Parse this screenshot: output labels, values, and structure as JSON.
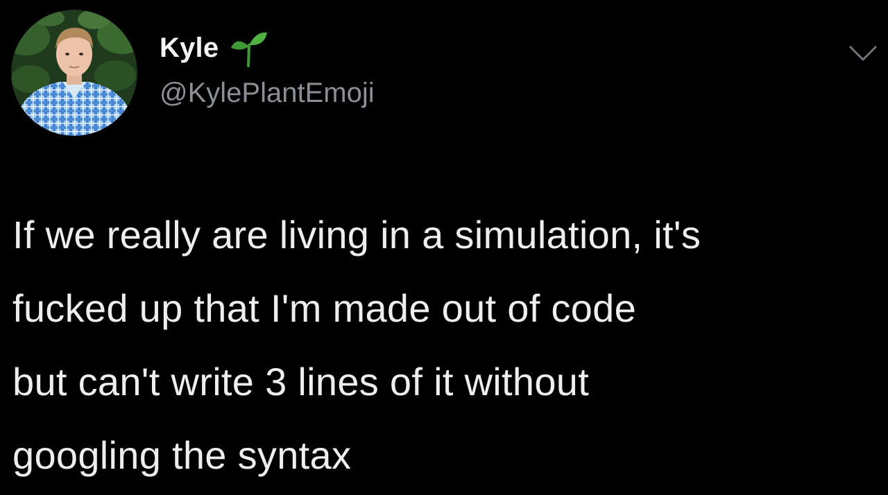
{
  "tweet": {
    "author": {
      "display_name": "Kyle",
      "name_emoji": "sprout-icon",
      "handle": "@KylePlantEmoji",
      "avatar": "avatar-photo"
    },
    "menu_icon": "chevron-down-icon",
    "text": "If we really are living in a simulation, it's\nfucked up that I'm made out of code\nbut can't write 3 lines of it without\ngoogling the syntax"
  },
  "colors": {
    "background": "#000000",
    "text": "#eeeeee",
    "handle": "#8b9096",
    "sprout_green": "#3f9a35",
    "chevron": "#6e767d"
  }
}
